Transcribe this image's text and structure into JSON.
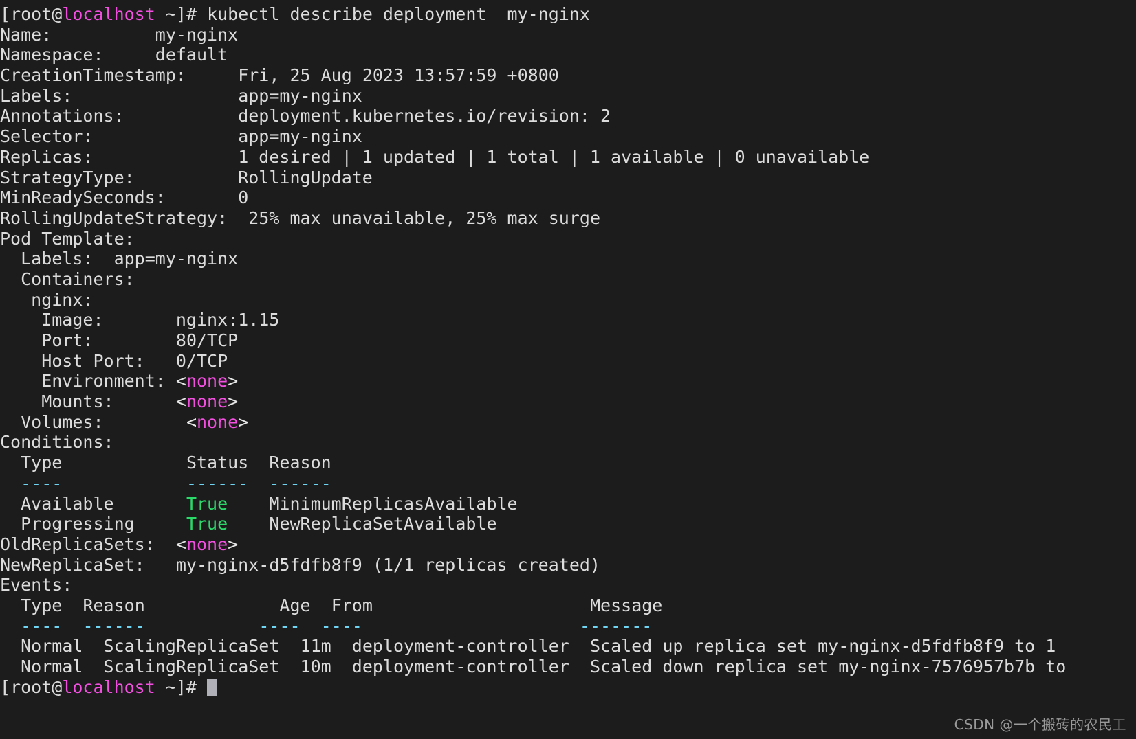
{
  "terminal": {
    "background_color": "#1c1c1c",
    "foreground_color": "#dcdcdc",
    "accent_magenta": "#f24fe0",
    "accent_green": "#2bd96b",
    "accent_cyan": "#6fd3f2",
    "cursor_color": "#b0b0b8"
  },
  "prompt": {
    "bracket_open": "[",
    "user": "root@",
    "host": "localhost",
    "path": " ~]# ",
    "command": "kubectl describe deployment  my-nginx"
  },
  "output": {
    "name_key": "Name:",
    "name_value": "my-nginx",
    "namespace_key": "Namespace:",
    "namespace_value": "default",
    "creationtimestamp_key": "CreationTimestamp:",
    "creationtimestamp_value": "Fri, 25 Aug 2023 13:57:59 +0800",
    "labels_key": "Labels:",
    "labels_value": "app=my-nginx",
    "annotations_key": "Annotations:",
    "annotations_value": "deployment.kubernetes.io/revision: 2",
    "selector_key": "Selector:",
    "selector_value": "app=my-nginx",
    "replicas_key": "Replicas:",
    "replicas_value": "1 desired | 1 updated | 1 total | 1 available | 0 unavailable",
    "strategytype_key": "StrategyType:",
    "strategytype_value": "RollingUpdate",
    "minreadyseconds_key": "MinReadySeconds:",
    "minreadyseconds_value": "0",
    "rollingupdatestrategy_key": "RollingUpdateStrategy:",
    "rollingupdatestrategy_value": "25% max unavailable, 25% max surge",
    "podtemplate_key": "Pod Template:",
    "pod_labels_key": "  Labels:  ",
    "pod_labels_value": "app=my-nginx",
    "containers_key": "  Containers:",
    "container_name": "   nginx:",
    "image_key": "    Image:",
    "image_value": "nginx:1.15",
    "port_key": "    Port:",
    "port_value": "80/TCP",
    "hostport_key": "    Host Port:",
    "hostport_value": "0/TCP",
    "environment_key": "    Environment:",
    "environment_value": "<none>",
    "mounts_key": "    Mounts:",
    "mounts_value": "<none>",
    "volumes_key": "  Volumes:",
    "volumes_value": "<none>",
    "conditions_key": "Conditions:",
    "conditions_columns": [
      "Type",
      "Status",
      "Reason"
    ],
    "conditions_rules": [
      "----",
      "------",
      "------"
    ],
    "conditions_rows": [
      {
        "type": "Available",
        "status": "True",
        "reason": "MinimumReplicasAvailable"
      },
      {
        "type": "Progressing",
        "status": "True",
        "reason": "NewReplicaSetAvailable"
      }
    ],
    "oldreplicasets_key": "OldReplicaSets:",
    "oldreplicasets_value": "<none>",
    "newreplicaset_key": "NewReplicaSet:",
    "newreplicaset_value": "my-nginx-d5fdfb8f9 (1/1 replicas created)",
    "events_key": "Events:",
    "events_columns": [
      "Type",
      "Reason",
      "Age",
      "From",
      "Message"
    ],
    "events_rules": [
      "----",
      "------",
      "----",
      "----",
      "-------"
    ],
    "events_rows": [
      {
        "type": "Normal",
        "reason": "ScalingReplicaSet",
        "age": "11m",
        "from": "deployment-controller",
        "message": "Scaled up replica set my-nginx-d5fdfb8f9 to 1"
      },
      {
        "type": "Normal",
        "reason": "ScalingReplicaSet",
        "age": "10m",
        "from": "deployment-controller",
        "message": "Scaled down replica set my-nginx-7576957b7b to"
      }
    ]
  },
  "prompt_end": {
    "bracket_open": "[",
    "user": "root@",
    "host": "localhost",
    "path": " ~]# "
  },
  "watermark": {
    "text": "CSDN @一个搬砖的农民工"
  }
}
